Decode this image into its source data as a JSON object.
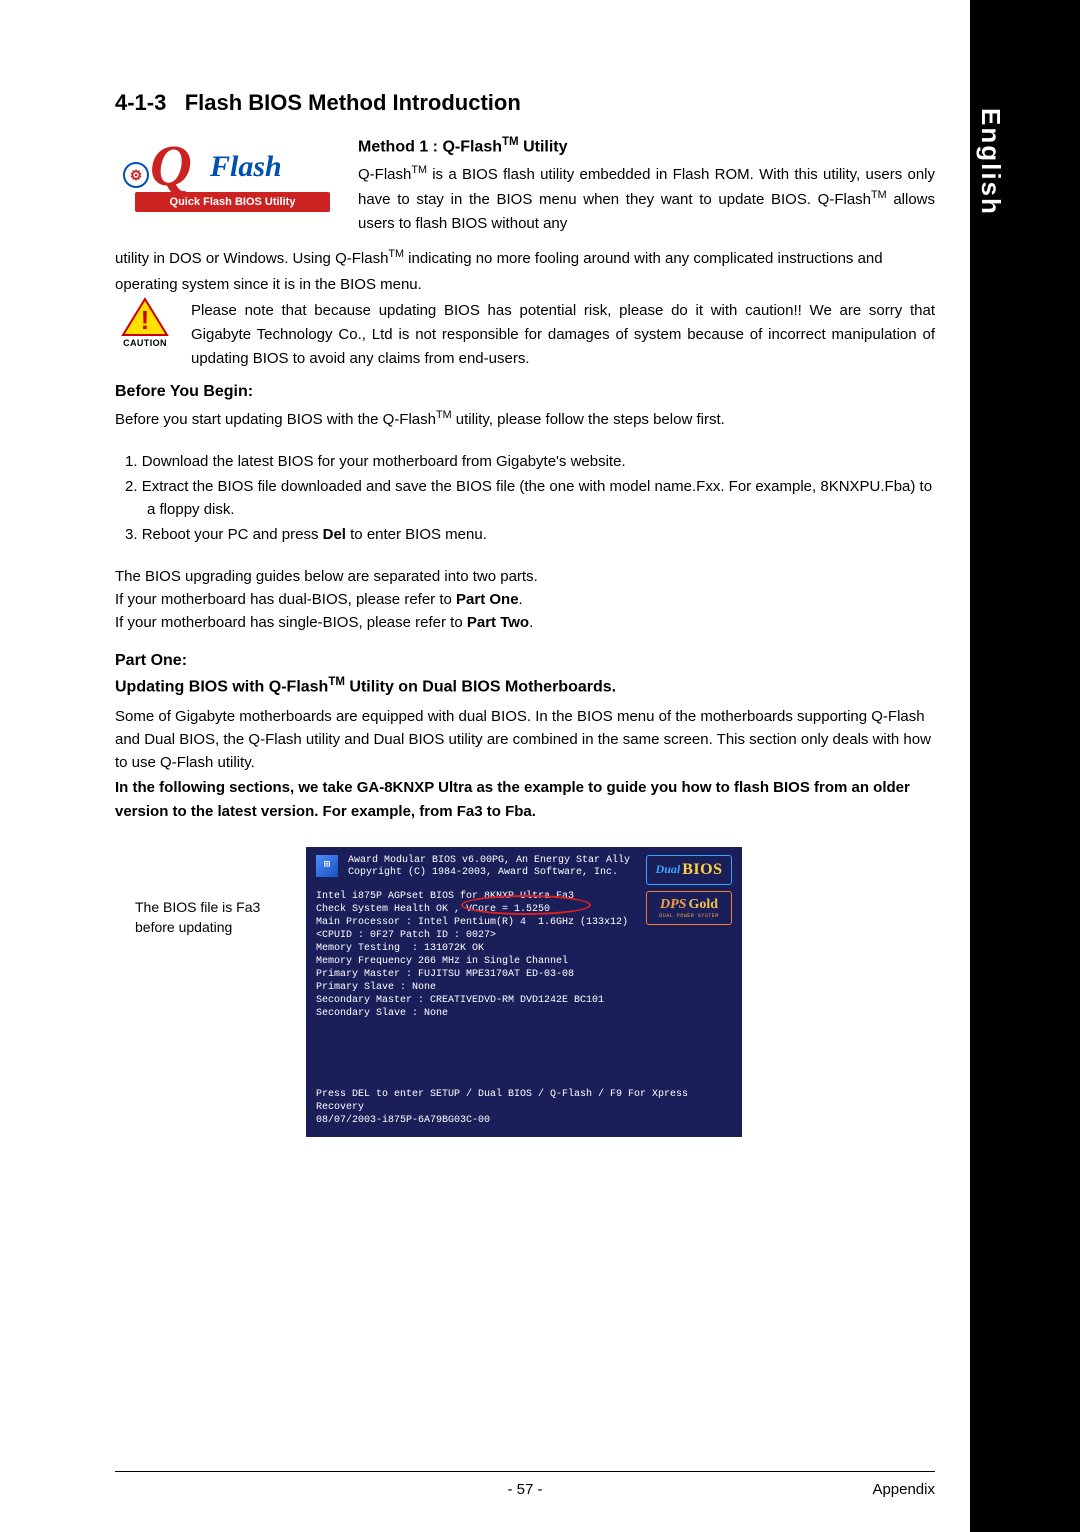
{
  "lang_tab": "English",
  "section": {
    "number": "4-1-3",
    "title": "Flash BIOS Method Introduction"
  },
  "qflash_logo": {
    "q": "Q",
    "flash": "Flash",
    "subtitle": "Quick Flash BIOS Utility",
    "icon": "⚙"
  },
  "method1": {
    "title": "Method 1 : Q-Flash™ Utility",
    "intro_right": "Q-Flash™ is a BIOS flash utility embedded in Flash ROM. With this utility, users only have to stay in the BIOS menu when they want to update BIOS. Q-Flash™ allows users to flash BIOS without any",
    "intro_cont": "utility in DOS or Windows. Using Q-Flash™ indicating no more fooling around with any complicated instructions and",
    "intro_cont2": "operating system since it is in the BIOS menu."
  },
  "caution": {
    "label": "CAUTION",
    "text": "Please note that because updating BIOS has potential risk, please do it with caution!! We are sorry that Gigabyte Technology Co., Ltd is not responsible for damages of system because of incorrect manipulation of updating BIOS to avoid any claims from end-users."
  },
  "before_begin": {
    "heading": "Before You Begin:",
    "intro": "Before you start updating BIOS with the Q-Flash™ utility, please follow the steps below first.",
    "steps": [
      "Download the latest BIOS for your motherboard from Gigabyte's website.",
      "Extract the BIOS file downloaded and save the BIOS file (the one with model name.Fxx. For example, 8KNXPU.Fba) to a floppy disk.",
      "Reboot your PC and press Del to enter BIOS menu."
    ]
  },
  "guide_split": {
    "line1": "The BIOS upgrading guides below are separated into two parts.",
    "line2_a": "If your motherboard has dual-BIOS, please refer to ",
    "line2_b": "Part One",
    "line3_a": "If your motherboard has single-BIOS, please refer to ",
    "line3_b": "Part Two"
  },
  "part_one": {
    "heading": "Part One:",
    "subheading": "Updating BIOS with Q-Flash™ Utility on Dual BIOS Motherboards.",
    "desc": "Some of Gigabyte motherboards are equipped with dual BIOS. In the BIOS menu of the motherboards supporting Q-Flash and Dual BIOS, the Q-Flash utility and Dual BIOS utility are combined in the same screen. This section only deals with how to use Q-Flash utility.",
    "bold_note": "In the following sections, we take GA-8KNXP Ultra as the example to guide you how to flash BIOS from an older version to the latest version. For example, from Fa3 to Fba."
  },
  "figure": {
    "caption": "The BIOS file is Fa3 before updating",
    "bios": {
      "header_line1": "Award Modular BIOS v6.00PG, An Energy Star Ally",
      "header_line2": "Copyright  (C) 1984-2003, Award Software, Inc.",
      "dual_label_1": "Dual",
      "dual_label_2": "BIOS",
      "dps_1": "DPS",
      "dps_2": "Gold",
      "dps_sub": "DUAL POWER SYSTEM",
      "body": [
        "Intel i875P AGPset BIOS for 8KNXP Ultra Fa3",
        "Check System Health OK , VCore = 1.5250",
        "Main Processor : Intel Pentium(R) 4  1.6GHz (133x12)",
        "<CPUID : 0F27 Patch ID : 0027>",
        "Memory Testing  : 131072K OK",
        "",
        "Memory Frequency 266 MHz in Single Channel",
        "Primary Master : FUJITSU MPE3170AT ED-03-08",
        "Primary Slave : None",
        "Secondary Master : CREATIVEDVD-RM DVD1242E BC101",
        "Secondary Slave : None"
      ],
      "footer1": "Press DEL to enter SETUP / Dual BIOS / Q-Flash / F9 For Xpress Recovery",
      "footer2": "08/07/2003-i875P-6A79BG03C-00"
    }
  },
  "page_footer": {
    "page": "- 57 -",
    "section": "Appendix"
  }
}
